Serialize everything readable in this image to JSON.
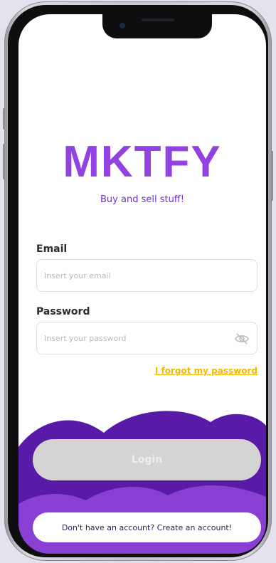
{
  "app": {
    "logo": "MKTFY",
    "tagline": "Buy and sell stuff!"
  },
  "form": {
    "email_label": "Email",
    "email_placeholder": "Insert your email",
    "email_value": "",
    "password_label": "Password",
    "password_placeholder": "Insert your password",
    "password_value": "",
    "forgot_label": "I forgot my password"
  },
  "actions": {
    "login_label": "Login",
    "create_account_label": "Don't have an account? Create an account!"
  },
  "colors": {
    "brand_purple": "#9142e0",
    "accent_yellow": "#f5b700",
    "wave_dark": "#5a1aa8",
    "wave_light": "#8a3fd4",
    "disabled_button": "#d4d4d4"
  },
  "icons": {
    "password_toggle": "eye-slash-icon"
  }
}
